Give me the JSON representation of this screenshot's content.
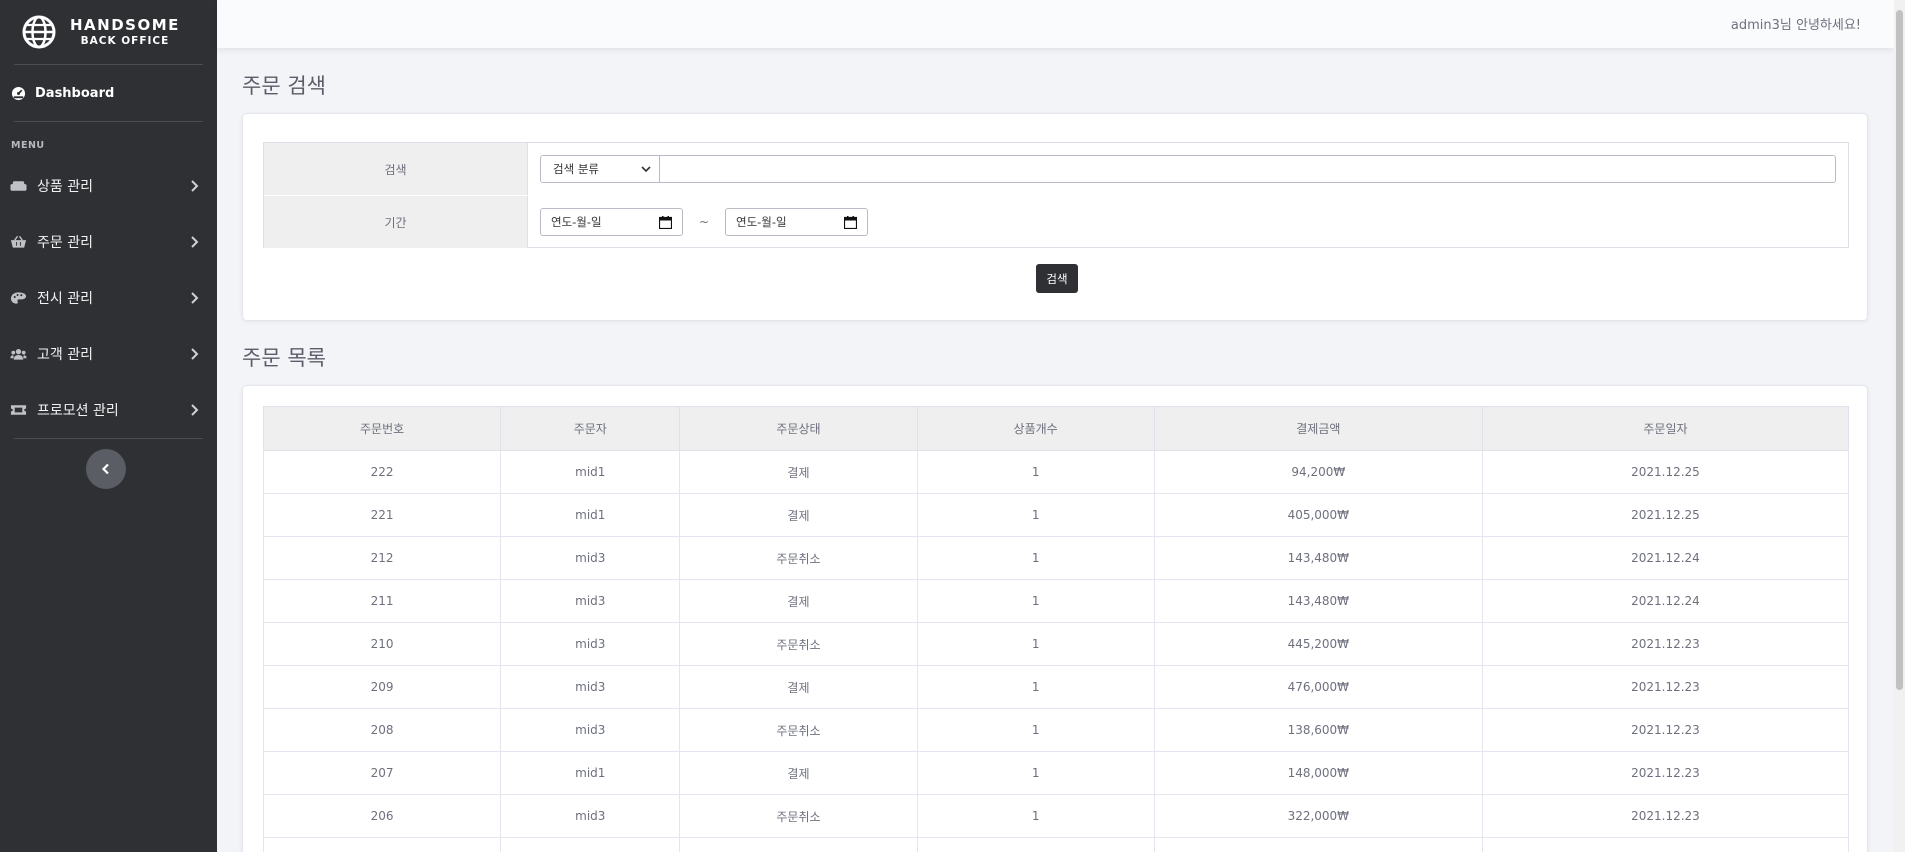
{
  "sidebar": {
    "brand_line1": "HANDSOME",
    "brand_line2": "BACK OFFICE",
    "dashboard_label": "Dashboard",
    "menu_heading": "MENU",
    "items": [
      {
        "label": "상품 관리",
        "icon": "couch-icon"
      },
      {
        "label": "주문 관리",
        "icon": "basket-icon"
      },
      {
        "label": "전시 관리",
        "icon": "palette-icon"
      },
      {
        "label": "고객 관리",
        "icon": "users-icon"
      },
      {
        "label": "프로모션 관리",
        "icon": "ticket-icon"
      }
    ]
  },
  "topbar": {
    "greeting": "admin3님 안녕하세요!"
  },
  "search": {
    "section_title": "주문 검색",
    "keyword_label": "검색",
    "category_select": "검색 분류",
    "keyword_value": "",
    "period_label": "기간",
    "date_from_placeholder": "연도-월-일",
    "date_separator": "~",
    "date_to_placeholder": "연도-월-일",
    "button_label": "검색"
  },
  "orders": {
    "section_title": "주문 목록",
    "columns": [
      "주문번호",
      "주문자",
      "주문상태",
      "상품개수",
      "결제금액",
      "주문일자"
    ],
    "rows": [
      [
        "222",
        "mid1",
        "결제",
        "1",
        "94,200₩",
        "2021.12.25"
      ],
      [
        "221",
        "mid1",
        "결제",
        "1",
        "405,000₩",
        "2021.12.25"
      ],
      [
        "212",
        "mid3",
        "주문취소",
        "1",
        "143,480₩",
        "2021.12.24"
      ],
      [
        "211",
        "mid3",
        "결제",
        "1",
        "143,480₩",
        "2021.12.24"
      ],
      [
        "210",
        "mid3",
        "주문취소",
        "1",
        "445,200₩",
        "2021.12.23"
      ],
      [
        "209",
        "mid3",
        "결제",
        "1",
        "476,000₩",
        "2021.12.23"
      ],
      [
        "208",
        "mid3",
        "주문취소",
        "1",
        "138,600₩",
        "2021.12.23"
      ],
      [
        "207",
        "mid1",
        "결제",
        "1",
        "148,000₩",
        "2021.12.23"
      ],
      [
        "206",
        "mid3",
        "주문취소",
        "1",
        "322,000₩",
        "2021.12.23"
      ],
      [
        "",
        "",
        "",
        "",
        "",
        ""
      ]
    ]
  }
}
